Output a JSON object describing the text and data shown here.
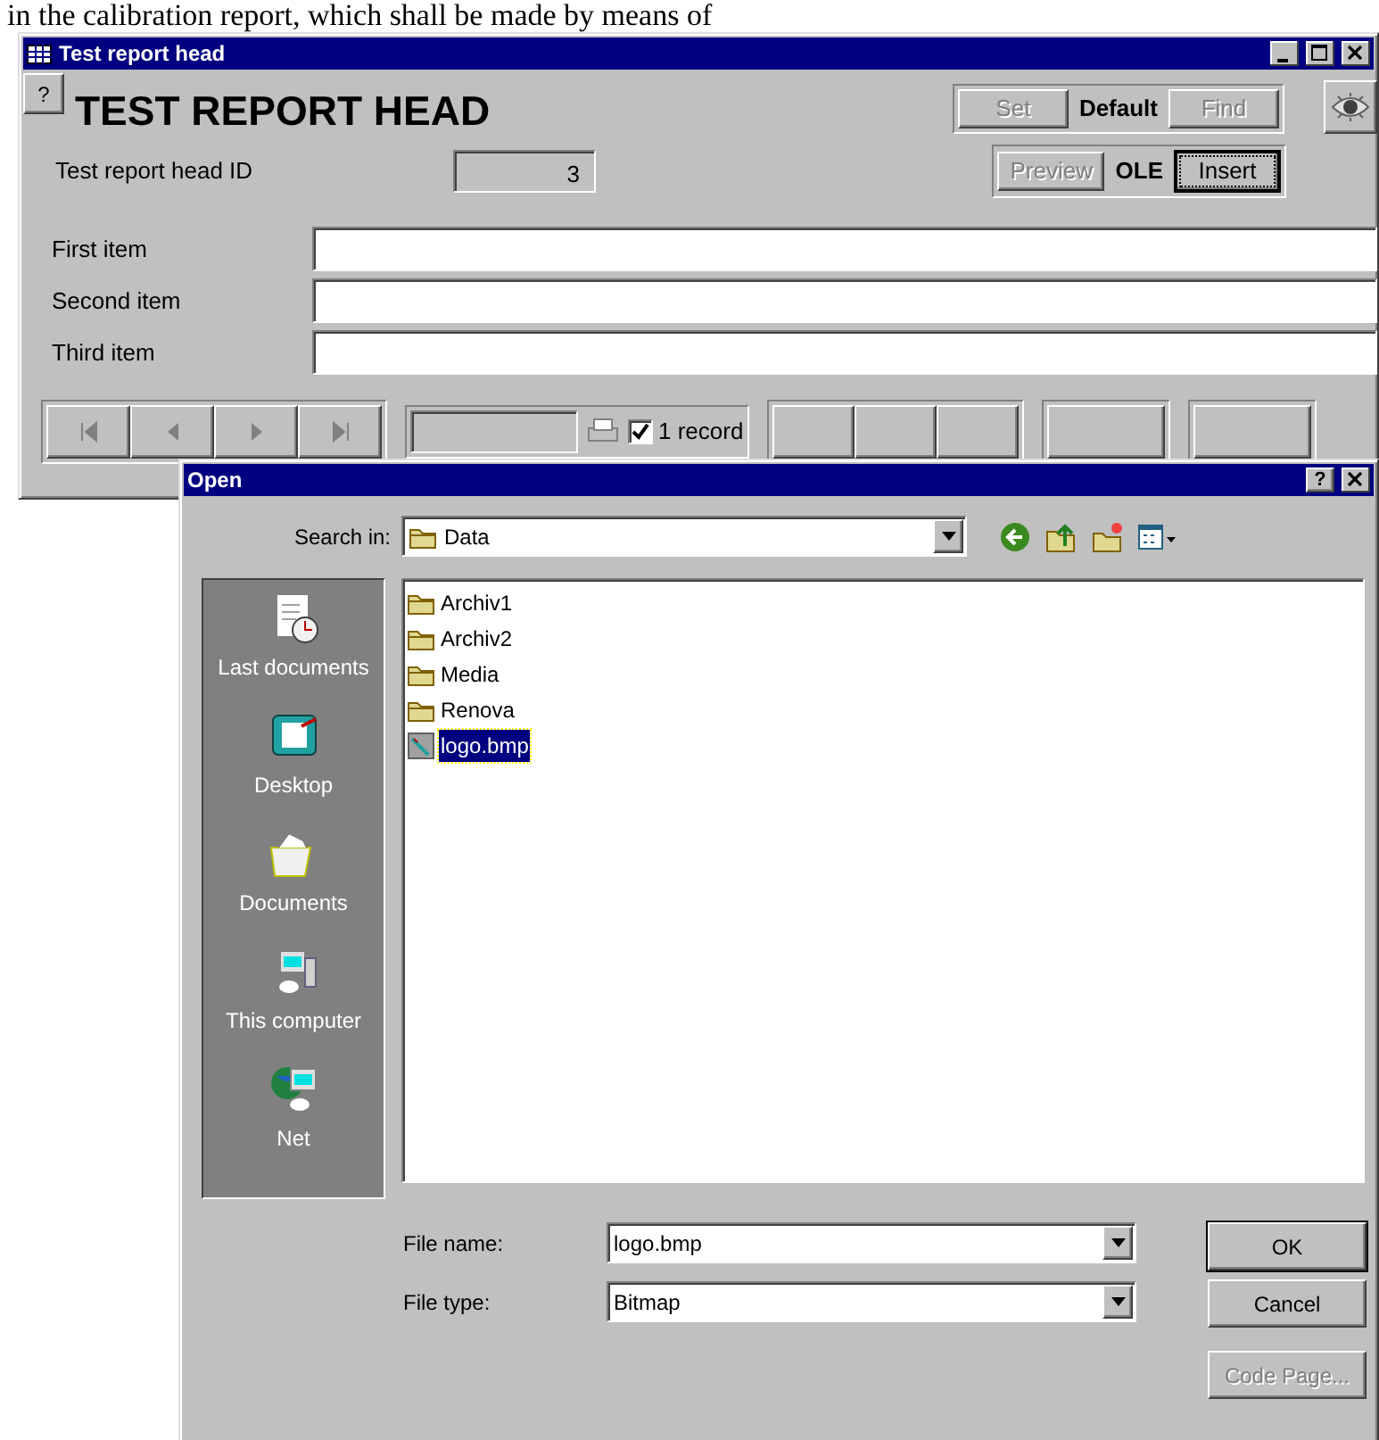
{
  "document_text": "in the calibration report, which shall be made by means of",
  "main_window": {
    "title": "Test report head",
    "help_button": "?",
    "heading": "TEST REPORT HEAD",
    "mode_buttons": [
      {
        "label": "Set",
        "kind": "button",
        "disabled": true
      },
      {
        "label": "Default",
        "kind": "label"
      },
      {
        "label": "Find",
        "kind": "button",
        "disabled": true
      }
    ],
    "id_label": "Test report head ID",
    "id_value": "3",
    "ole_buttons": [
      {
        "label": "Preview",
        "kind": "button",
        "disabled": true,
        "focused": false
      },
      {
        "label": "OLE",
        "kind": "label"
      },
      {
        "label": "Insert",
        "kind": "button",
        "disabled": false,
        "focused": true
      }
    ],
    "items": [
      {
        "label": "First item"
      },
      {
        "label": "Second item"
      },
      {
        "label": "Third item"
      }
    ],
    "record_checkbox": {
      "label": "1 record",
      "checked": true
    }
  },
  "open_dialog": {
    "title": "Open",
    "help_button": "?",
    "search_in_label": "Search in:",
    "search_in_value": "Data",
    "places": [
      {
        "label": "Last documents",
        "kind": "recent"
      },
      {
        "label": "Desktop",
        "kind": "desktop"
      },
      {
        "label": "Documents",
        "kind": "documents"
      },
      {
        "label": "This computer",
        "kind": "computer"
      },
      {
        "label": "Net",
        "kind": "network"
      }
    ],
    "files": [
      {
        "name": "Archiv1",
        "kind": "folder",
        "selected": false
      },
      {
        "name": "Archiv2",
        "kind": "folder",
        "selected": false
      },
      {
        "name": "Media",
        "kind": "folder",
        "selected": false
      },
      {
        "name": "Renova",
        "kind": "folder",
        "selected": false
      },
      {
        "name": "logo.bmp",
        "kind": "bitmap",
        "selected": true
      }
    ],
    "file_name_label": "File name:",
    "file_name": "logo.bmp",
    "file_type_label": "File type:",
    "file_type": "Bitmap",
    "buttons": [
      {
        "label": "OK",
        "default": true,
        "disabled": false
      },
      {
        "label": "Cancel",
        "default": false,
        "disabled": false
      },
      {
        "label": "Code Page...",
        "default": false,
        "disabled": true
      }
    ]
  }
}
